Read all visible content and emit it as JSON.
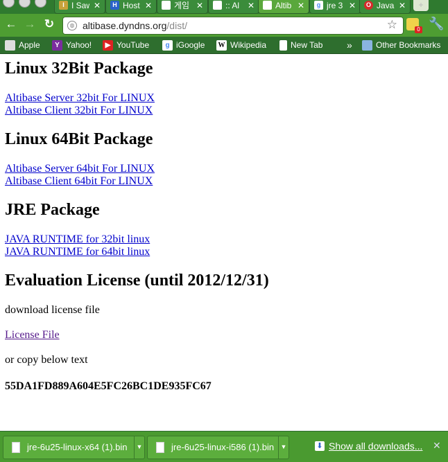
{
  "tabs": [
    {
      "label": "I Saw",
      "favicon": "I",
      "fav_color": "#c8a23a"
    },
    {
      "label": "Host",
      "favicon": "H",
      "fav_color": "#2a62c9"
    },
    {
      "label": "게임",
      "favicon": "",
      "fav_color": "#ffffff"
    },
    {
      "label": ":: Al",
      "favicon": "",
      "fav_color": "#ffffff"
    },
    {
      "label": "Altib",
      "favicon": "",
      "fav_color": "#ffffff"
    },
    {
      "label": "jre 3",
      "favicon": "g",
      "fav_color": "#ffffff"
    },
    {
      "label": "Java",
      "favicon": "O",
      "fav_color": "#d62a2a"
    }
  ],
  "toolbar": {
    "url_host": "altibase.dyndns.org",
    "url_path": "/dist/",
    "ext_badge": "0"
  },
  "bookmarks": [
    {
      "label": "Apple",
      "icon": "apple-icon",
      "glyph": "",
      "color": "#ffffff"
    },
    {
      "label": "Yahoo!",
      "icon": "yahoo-icon",
      "glyph": "Y",
      "color": "#7b2d9e"
    },
    {
      "label": "YouTube",
      "icon": "youtube-icon",
      "glyph": "▶",
      "color": "#d22"
    },
    {
      "label": "iGoogle",
      "icon": "igoogle-icon",
      "glyph": "g",
      "color": "#4a8af4"
    },
    {
      "label": "Wikipedia",
      "icon": "wikipedia-icon",
      "glyph": "W",
      "color": "#ffffff"
    },
    {
      "label": "New Tab",
      "icon": "page-icon",
      "glyph": "",
      "color": "#ffffff"
    }
  ],
  "bookmarks_overflow": "»",
  "other_bookmarks": "Other Bookmarks",
  "page": {
    "h_linux32": "Linux 32Bit Package",
    "link_server32": "Altibase Server 32bit For LINUX ",
    "link_client32": "Altibase Client 32bit For LINUX ",
    "h_linux64": "Linux 64Bit Package",
    "link_server64": "Altibase Server 64bit For LINUX ",
    "link_client64": "Altibase Client 64bit For LINUX ",
    "h_jre": "JRE Package",
    "link_jre32": "JAVA RUNTIME for 32bit linux ",
    "link_jre64": "JAVA RUNTIME for 64bit linux",
    "h_license": "Evaluation License (until 2012/12/31)",
    "download_license_text": "download license file",
    "link_license": "License File ",
    "copy_text": "or copy below text",
    "license_key": "55DA1FD889A604E5FC26BC1DE935FC67"
  },
  "downloads": {
    "items": [
      {
        "name": "jre-6u25-linux-x64 (1).bin"
      },
      {
        "name": "jre-6u25-linux-i586 (1).bin"
      }
    ],
    "show_all": "Show all downloads..."
  }
}
